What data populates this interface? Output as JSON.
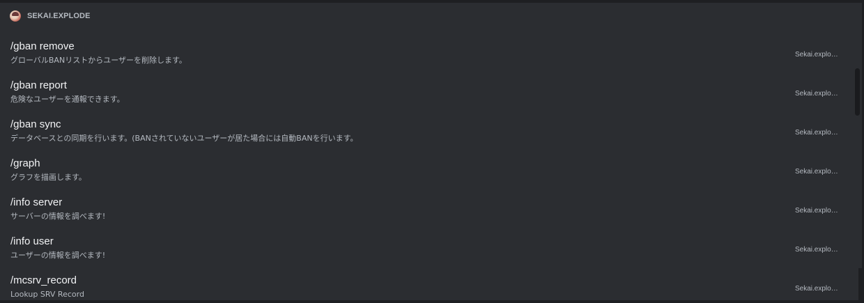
{
  "header": {
    "app_name": "SEKAI.EXPLODE"
  },
  "commands": [
    {
      "name": "/gban remove",
      "description": "グローバルBANリストからユーザーを削除します。",
      "source": "Sekai.explo…"
    },
    {
      "name": "/gban report",
      "description": "危険なユーザーを通報できます。",
      "source": "Sekai.explo…"
    },
    {
      "name": "/gban sync",
      "description": "データベースとの同期を行います。(BANされていないユーザーが居た場合には自動BANを行います。",
      "source": "Sekai.explo…"
    },
    {
      "name": "/graph",
      "description": "グラフを描画します。",
      "source": "Sekai.explo…"
    },
    {
      "name": "/info server",
      "description": "サーバーの情報を調べます!",
      "source": "Sekai.explo…"
    },
    {
      "name": "/info user",
      "description": "ユーザーの情報を調べます!",
      "source": "Sekai.explo…"
    },
    {
      "name": "/mcsrv_record",
      "description": "Lookup SRV Record",
      "source": "Sekai.explo…"
    }
  ],
  "colors": {
    "background": "#2b2d31",
    "frame": "#1e1f22",
    "name_text": "#f2f3f5",
    "muted_text": "#b5bac1"
  },
  "icons": {
    "app": "bot-avatar-icon"
  }
}
